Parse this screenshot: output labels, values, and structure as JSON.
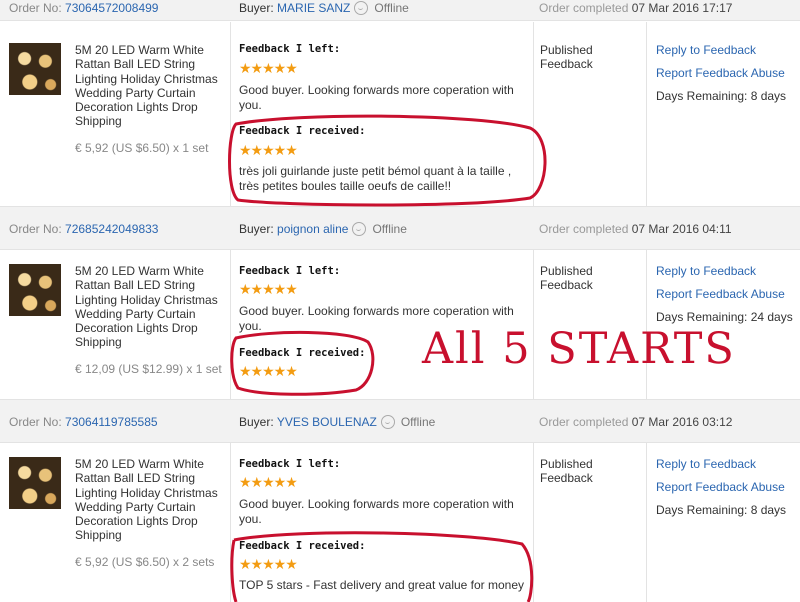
{
  "labels": {
    "order_no": "Order No:",
    "buyer": "Buyer:",
    "offline": "Offline",
    "order_completed": "Order completed",
    "feedback_left": "Feedback I left:",
    "feedback_received": "Feedback I received:",
    "published": "Published",
    "feedback": "Feedback",
    "reply": "Reply to Feedback",
    "report": "Report Feedback Abuse"
  },
  "annotation": "All 5 STARTS",
  "orders": [
    {
      "order_no": "73064572008499",
      "buyer": "MARIE SANZ",
      "date": "07 Mar 2016 17:17",
      "title": "5M 20 LED Warm White Rattan Ball LED String Lighting Holiday Christmas Wedding Party Curtain Decoration Lights Drop Shipping",
      "price": "€ 5,92 (US $6.50) x 1 set",
      "stars_left": "★★★★★",
      "left_text": "Good buyer. Looking forwards more coperation with you.",
      "stars_received": "★★★★★",
      "received_text": "très joli guirlande juste petit bémol quant à la taille , très petites boules taille oeufs de caille!!",
      "days": "Days Remaining: 8 days"
    },
    {
      "order_no": "72685242049833",
      "buyer": "poignon aline",
      "date": "07 Mar 2016 04:11",
      "title": "5M 20 LED Warm White Rattan Ball LED String Lighting Holiday Christmas Wedding Party Curtain Decoration Lights Drop Shipping",
      "price": "€ 12,09 (US $12.99) x 1 set",
      "stars_left": "★★★★★",
      "left_text": "Good buyer. Looking forwards more coperation with you.",
      "stars_received": "★★★★★",
      "received_text": "",
      "days": "Days Remaining: 24 days"
    },
    {
      "order_no": "73064119785585",
      "buyer": "YVES BOULENAZ",
      "date": "07 Mar 2016 03:12",
      "title": "5M 20 LED Warm White Rattan Ball LED String Lighting Holiday Christmas Wedding Party Curtain Decoration Lights Drop Shipping",
      "price": "€ 5,92 (US $6.50) x 2 sets",
      "stars_left": "★★★★★",
      "left_text": "Good buyer. Looking forwards more coperation with you.",
      "stars_received": "★★★★★",
      "received_text": "TOP 5 stars - Fast delivery and great value for money",
      "days": "Days Remaining: 8 days"
    }
  ],
  "colors": {
    "link": "#2b66b0",
    "star": "#f39c12",
    "annotation": "#c8102e",
    "header_bg": "#f2f2f2"
  }
}
